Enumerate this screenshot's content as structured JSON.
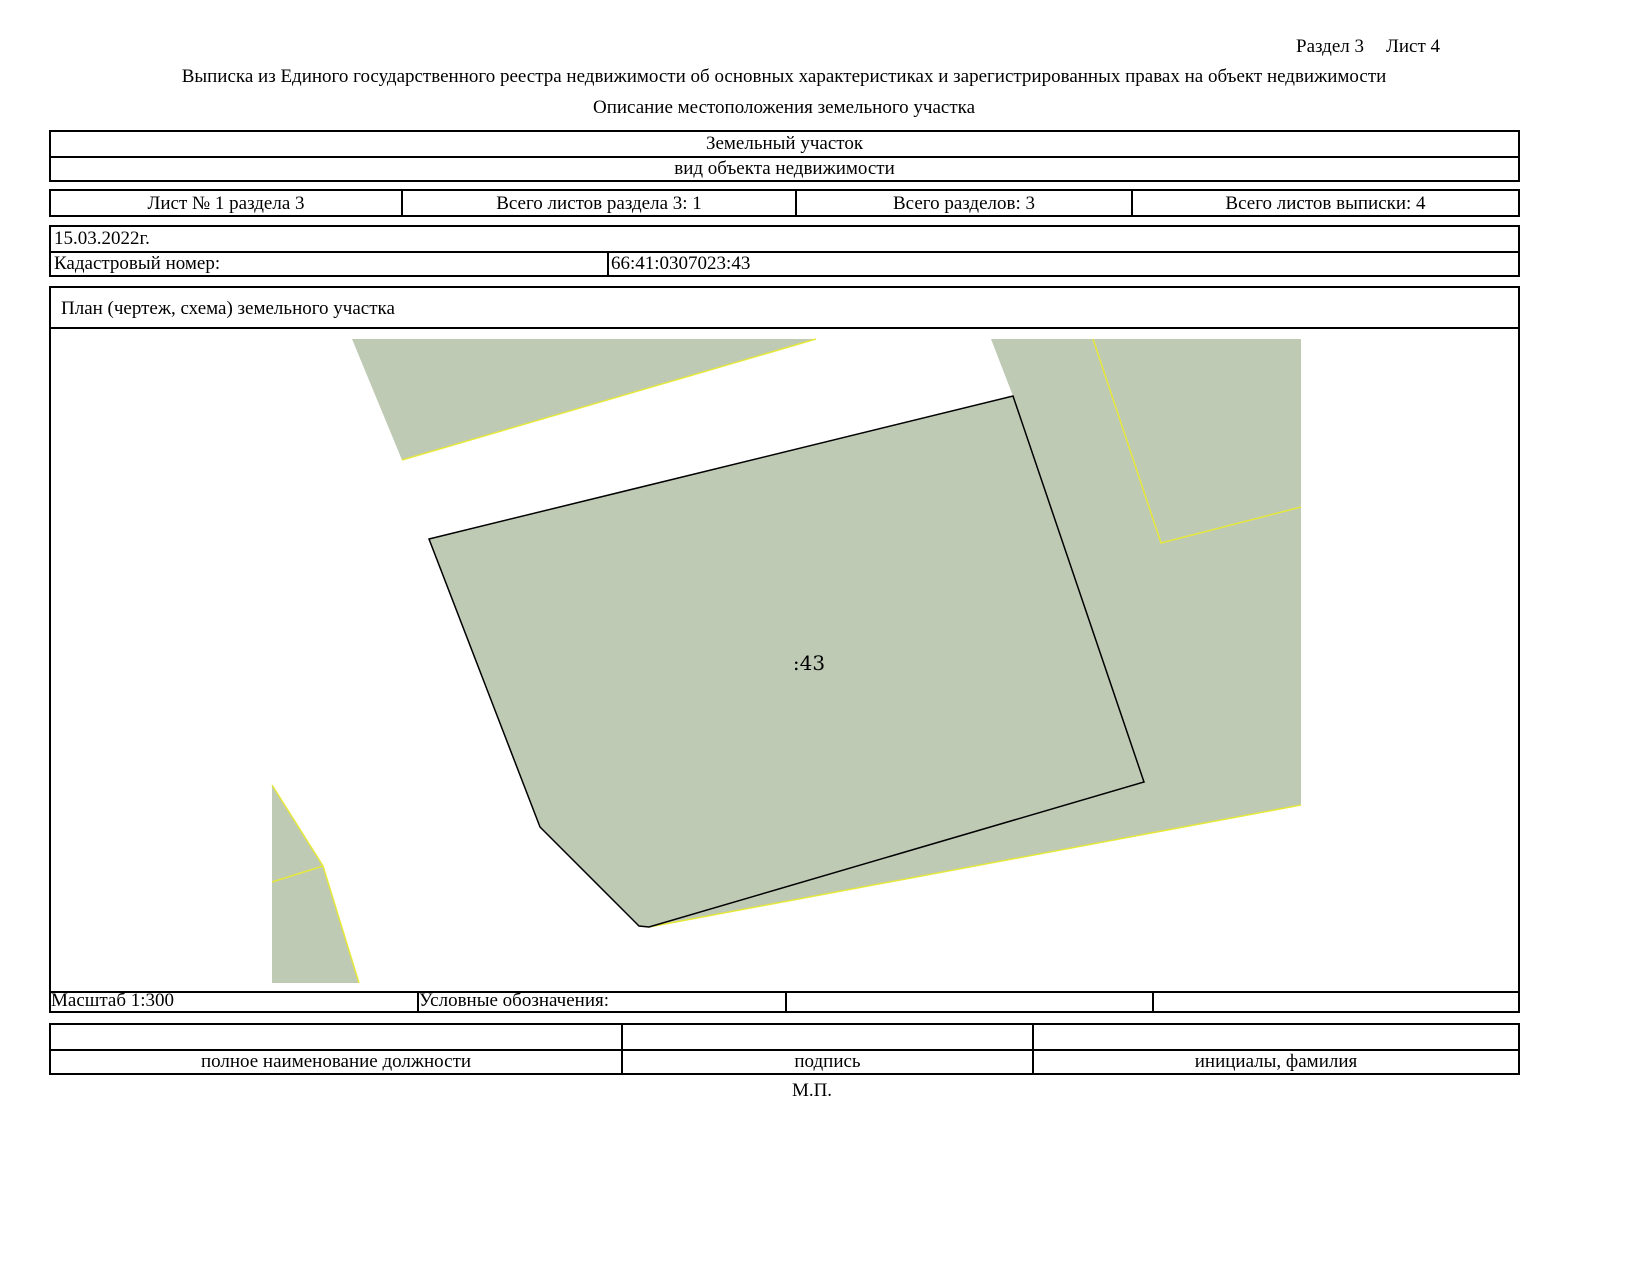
{
  "header": {
    "section": "Раздел 3",
    "sheet": "Лист 4",
    "title": "Выписка из Единого государственного реестра недвижимости об основных характеристиках и зарегистрированных правах на объект недвижимости",
    "subtitle": "Описание местоположения земельного участка"
  },
  "object": {
    "type": "Земельный участок",
    "type_caption": "вид объекта недвижимости"
  },
  "sheets": {
    "sheet_no": "Лист № 1 раздела 3",
    "total_section_sheets": "Всего листов раздела 3: 1",
    "total_sections": "Всего разделов: 3",
    "total_extract_sheets": "Всего листов выписки: 4"
  },
  "info": {
    "date": "15.03.2022г.",
    "cadastral_label": "Кадастровый номер:",
    "cadastral_number": "66:41:0307023:43"
  },
  "plan": {
    "title": "План (чертеж, схема) земельного участка",
    "parcel_label": ":43",
    "colors": {
      "parcel_fill": "#bfcab5",
      "neighbor_border": "#e5e83a",
      "parcel_border": "#000000"
    }
  },
  "legend": {
    "scale": "Масштаб 1:300",
    "conventions": "Условные обозначения:"
  },
  "signature": {
    "position_caption": "полное наименование должности",
    "signature_caption": "подпись",
    "name_caption": "инициалы, фамилия",
    "stamp": "М.П."
  }
}
